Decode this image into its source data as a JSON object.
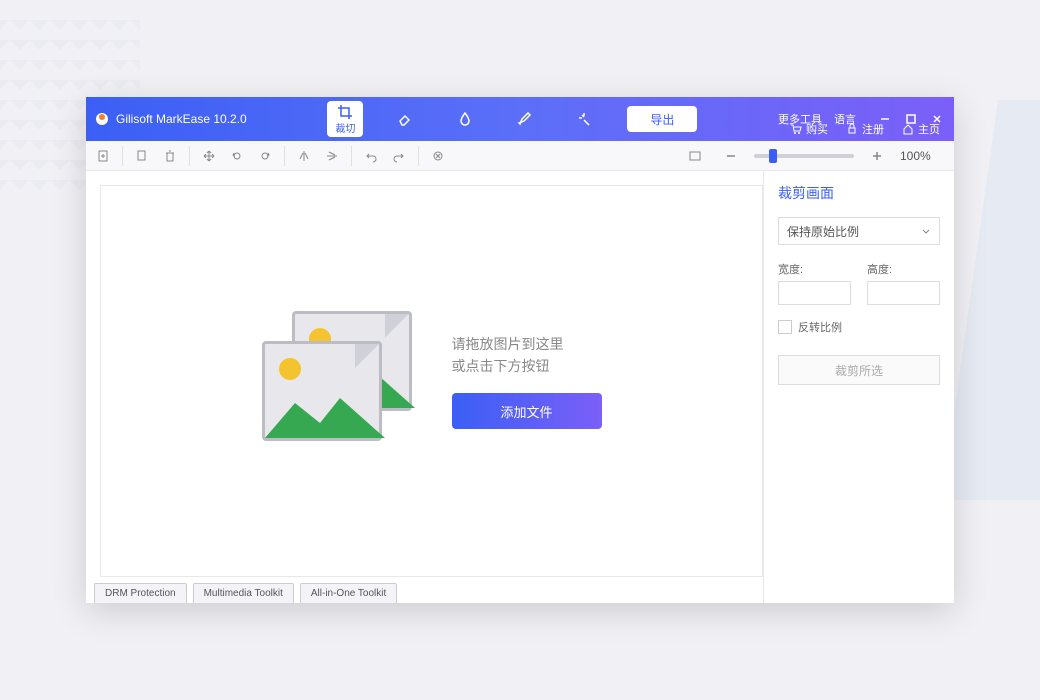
{
  "app": {
    "title": "Gilisoft MarkEase 10.2.0"
  },
  "tools": {
    "crop": "裁切",
    "export": "导出"
  },
  "menu": {
    "more_tools": "更多工具",
    "language": "语言",
    "buy": "购买",
    "register": "注册",
    "home": "主页"
  },
  "zoom": {
    "value": "100%"
  },
  "dropzone": {
    "line1": "请拖放图片到这里",
    "line2": "或点击下方按钮",
    "button": "添加文件"
  },
  "tabs": {
    "drm": "DRM Protection",
    "multimedia": "Multimedia Toolkit",
    "allinone": "All-in-One Toolkit"
  },
  "panel": {
    "title": "裁剪画面",
    "ratio": "保持原始比例",
    "width_label": "宽度:",
    "height_label": "高度:",
    "invert": "反转比例",
    "crop_selected": "裁剪所选"
  },
  "icons": {
    "crop": "crop",
    "eraser": "eraser",
    "drop": "drop",
    "brush": "brush",
    "wand": "wand"
  }
}
